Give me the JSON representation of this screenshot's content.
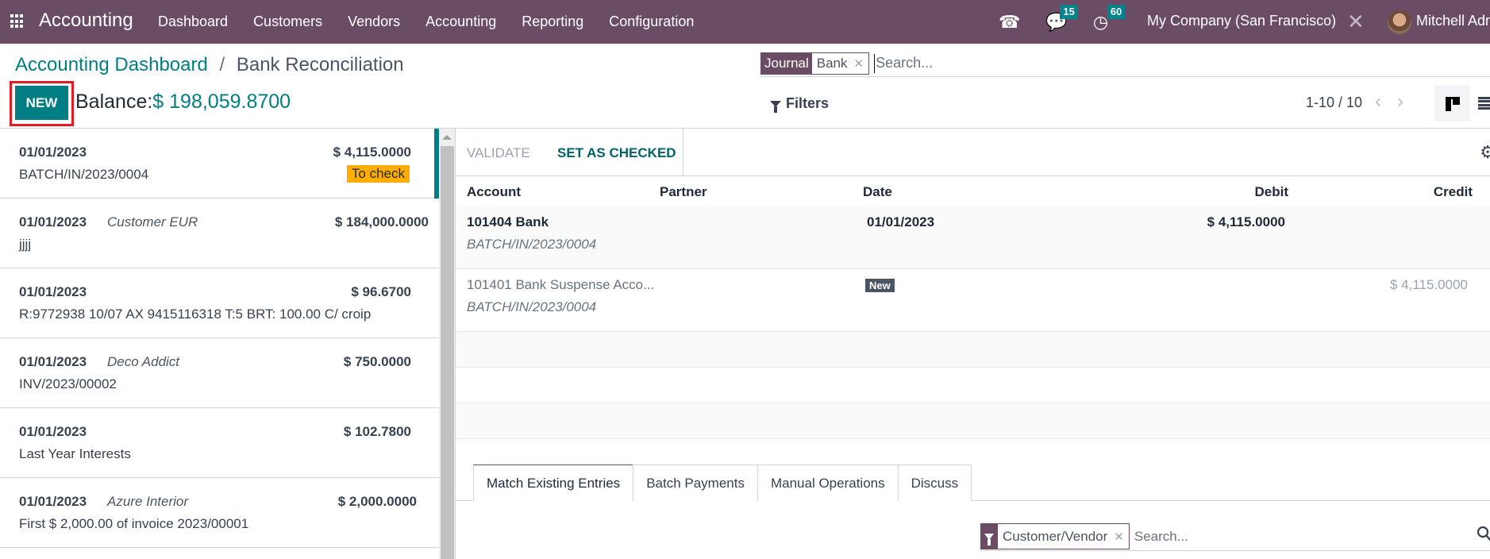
{
  "navbar": {
    "app_name": "Accounting",
    "menu": [
      "Dashboard",
      "Customers",
      "Vendors",
      "Accounting",
      "Reporting",
      "Configuration"
    ],
    "messages_count": "15",
    "activities_count": "60",
    "company": "My Company (San Francisco)",
    "user": "Mitchell Admin"
  },
  "control_panel": {
    "breadcrumb_parent": "Accounting Dashboard",
    "breadcrumb_sep": "/",
    "breadcrumb_current": "Bank Reconciliation",
    "new_label": "NEW",
    "balance_label": "Balance:",
    "balance_value": "$ 198,059.8700",
    "search": {
      "facet_label": "Journal",
      "facet_value": "Bank",
      "placeholder": "Search..."
    },
    "filters_label": "Filters",
    "pager": "1-10 / 10",
    "highlight_color": "#e21c24"
  },
  "statements": [
    {
      "date": "01/01/2023",
      "partner": "",
      "amount": "$ 4,115.0000",
      "label": "BATCH/IN/2023/0004",
      "badge": "To check",
      "active": true
    },
    {
      "date": "01/01/2023",
      "partner": "Customer EUR",
      "amount": "$ 184,000.0000",
      "label": "jjjj",
      "badge": "",
      "active": false
    },
    {
      "date": "01/01/2023",
      "partner": "",
      "amount": "$ 96.6700",
      "label": "R:9772938 10/07 AX 9415116318 T:5 BRT: 100.00 C/ croip",
      "badge": "",
      "active": false
    },
    {
      "date": "01/01/2023",
      "partner": "Deco Addict",
      "amount": "$ 750.0000",
      "label": "INV/2023/00002",
      "badge": "",
      "active": false
    },
    {
      "date": "01/01/2023",
      "partner": "",
      "amount": "$ 102.7800",
      "label": "Last Year Interests",
      "badge": "",
      "active": false
    },
    {
      "date": "01/01/2023",
      "partner": "Azure Interior",
      "amount": "$ 2,000.0000",
      "label": "First $ 2,000.00 of invoice 2023/00001",
      "badge": "",
      "active": false
    }
  ],
  "reconcile": {
    "validate_label": "VALIDATE",
    "set_checked_label": "SET AS CHECKED",
    "columns": [
      "Account",
      "Partner",
      "Date",
      "Debit",
      "Credit"
    ],
    "lines": [
      {
        "account": "101404 Bank",
        "ref": "BATCH/IN/2023/0004",
        "date": "01/01/2023",
        "debit": "$ 4,115.0000",
        "credit": ""
      },
      {
        "account": "101401 Bank Suspense Acco...",
        "ref": "BATCH/IN/2023/0004",
        "date_badge": "New",
        "debit": "",
        "credit": "$ 4,115.0000"
      }
    ],
    "tabs": [
      "Match Existing Entries",
      "Batch Payments",
      "Manual Operations",
      "Discuss"
    ],
    "active_tab": "Match Existing Entries",
    "bottom_search": {
      "facet_value": "Customer/Vendor",
      "placeholder": "Search..."
    }
  }
}
